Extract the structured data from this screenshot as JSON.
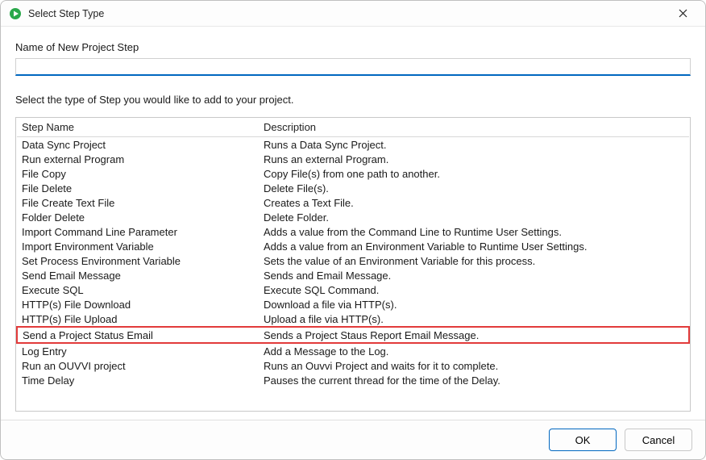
{
  "window": {
    "title": "Select Step Type"
  },
  "form": {
    "name_label": "Name of New Project Step",
    "name_value": "",
    "instruction": "Select the type of Step you would like to add to your project."
  },
  "table": {
    "columns": {
      "name": "Step Name",
      "description": "Description"
    },
    "rows": [
      {
        "name": "Data Sync Project",
        "desc": "Runs a Data Sync Project."
      },
      {
        "name": "Run external Program",
        "desc": "Runs an external Program."
      },
      {
        "name": "File Copy",
        "desc": "Copy File(s) from one path to another."
      },
      {
        "name": "File Delete",
        "desc": "Delete File(s)."
      },
      {
        "name": "File Create Text File",
        "desc": "Creates a Text File."
      },
      {
        "name": "Folder Delete",
        "desc": "Delete Folder."
      },
      {
        "name": "Import Command Line Parameter",
        "desc": "Adds a value from the Command Line to Runtime User Settings."
      },
      {
        "name": "Import Environment Variable",
        "desc": "Adds a value from an Environment Variable to Runtime User Settings."
      },
      {
        "name": "Set Process Environment Variable",
        "desc": "Sets the value of an Environment Variable for this process."
      },
      {
        "name": "Send Email Message",
        "desc": "Sends and Email Message."
      },
      {
        "name": "Execute SQL",
        "desc": "Execute SQL Command."
      },
      {
        "name": "HTTP(s) File Download",
        "desc": "Download a file via HTTP(s)."
      },
      {
        "name": "HTTP(s) File Upload",
        "desc": "Upload a file via HTTP(s)."
      },
      {
        "name": "Send a Project Status Email",
        "desc": "Sends a Project Staus Report Email Message.",
        "highlight": true
      },
      {
        "name": "Log Entry",
        "desc": "Add a Message to the Log."
      },
      {
        "name": "Run an OUVVI project",
        "desc": "Runs an Ouvvi Project and waits for it to complete."
      },
      {
        "name": "Time Delay",
        "desc": "Pauses the current thread for the time of the Delay."
      }
    ]
  },
  "footer": {
    "ok": "OK",
    "cancel": "Cancel"
  }
}
